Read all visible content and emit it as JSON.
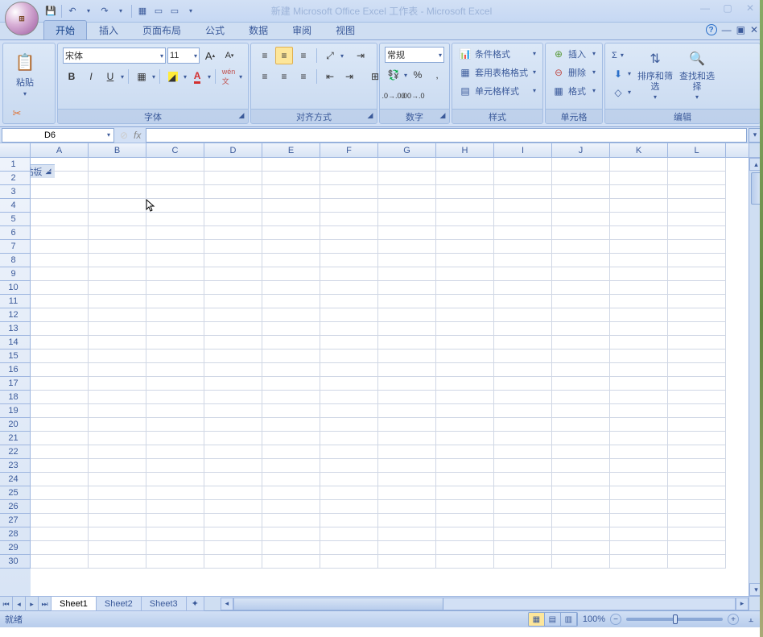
{
  "title": "新建 Microsoft Office Excel 工作表 - Microsoft Excel",
  "qat": {
    "save": "💾",
    "undo": "↶",
    "redo": "↷"
  },
  "tabs": [
    "开始",
    "插入",
    "页面布局",
    "公式",
    "数据",
    "审阅",
    "视图"
  ],
  "active_tab": "开始",
  "ribbon": {
    "clipboard": {
      "label": "剪贴板",
      "paste": "粘贴"
    },
    "font": {
      "label": "字体",
      "name": "宋体",
      "size": "11",
      "bold": "B",
      "italic": "I",
      "underline": "U"
    },
    "align": {
      "label": "对齐方式"
    },
    "number": {
      "label": "数字",
      "format": "常规",
      "percent": "%",
      "comma": ","
    },
    "styles": {
      "label": "样式",
      "cond": "条件格式",
      "table": "套用表格格式",
      "cell": "单元格样式"
    },
    "cells": {
      "label": "单元格",
      "insert": "插入",
      "delete": "删除",
      "format": "格式"
    },
    "editing": {
      "label": "编辑",
      "sum": "Σ",
      "sort": "排序和筛选",
      "find": "查找和选择"
    }
  },
  "name_box": "D6",
  "fx": "fx",
  "columns": [
    "A",
    "B",
    "C",
    "D",
    "E",
    "F",
    "G",
    "H",
    "I",
    "J",
    "K",
    "L"
  ],
  "rows": [
    "1",
    "2",
    "3",
    "4",
    "5",
    "6",
    "7",
    "8",
    "9",
    "10",
    "11",
    "12",
    "13",
    "14",
    "15",
    "16",
    "17",
    "18",
    "19",
    "20",
    "21",
    "22",
    "23",
    "24",
    "25",
    "26",
    "27",
    "28",
    "29",
    "30"
  ],
  "sheets": [
    "Sheet1",
    "Sheet2",
    "Sheet3"
  ],
  "active_sheet": "Sheet1",
  "status": "就绪",
  "zoom": "100%"
}
